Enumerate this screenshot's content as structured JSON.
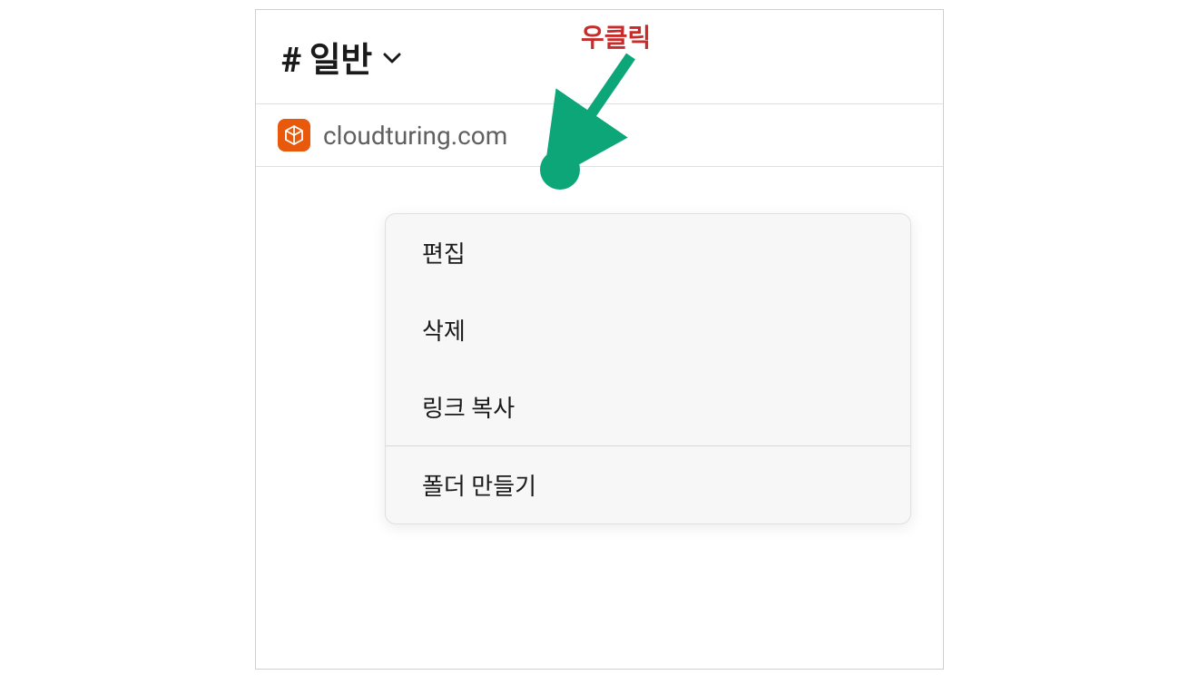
{
  "channel": {
    "prefix": "#",
    "name": "일반"
  },
  "bookmark": {
    "label": "cloudturing.com",
    "plus": "+"
  },
  "contextMenu": {
    "items": [
      "편집",
      "삭제",
      "링크 복사"
    ],
    "secondaryItems": [
      "폴더 만들기"
    ]
  },
  "annotation": {
    "label": "우클릭"
  },
  "colors": {
    "accent": "#e8590c",
    "annotation_green": "#0ca678",
    "annotation_red": "#c92a2a"
  }
}
